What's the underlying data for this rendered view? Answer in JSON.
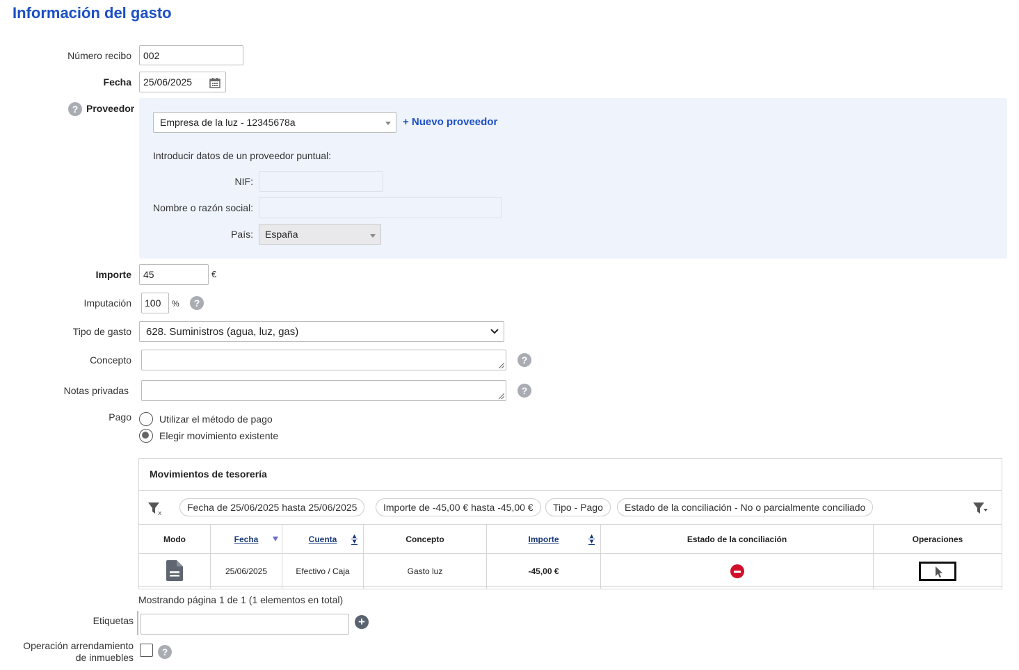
{
  "page": {
    "title": "Información del gasto"
  },
  "form": {
    "recibo": {
      "label": "Número recibo",
      "value": "002"
    },
    "fecha": {
      "label": "Fecha",
      "value": "25/06/2025"
    },
    "proveedor": {
      "label": "Proveedor",
      "selected": "Empresa de la luz - 12345678a",
      "nuevo_link": "+ Nuevo proveedor",
      "puntual_text": "Introducir datos de un proveedor puntual:",
      "nif_label": "NIF:",
      "nif_value": "",
      "nombre_label": "Nombre o razón social:",
      "nombre_value": "",
      "pais_label": "País:",
      "pais_value": "España"
    },
    "importe": {
      "label": "Importe",
      "value": "45",
      "unit": "€"
    },
    "imputacion": {
      "label": "Imputación",
      "value": "100",
      "unit": "%"
    },
    "tipo_gasto": {
      "label": "Tipo de gasto",
      "value": "628. Suministros (agua, luz, gas)"
    },
    "concepto": {
      "label": "Concepto",
      "value": ""
    },
    "notas": {
      "label": "Notas privadas",
      "value": ""
    },
    "pago": {
      "label": "Pago",
      "options": [
        {
          "label": "Utilizar el método de pago",
          "selected": false
        },
        {
          "label": "Elegir movimiento existente",
          "selected": true
        }
      ]
    },
    "etiquetas": {
      "label": "Etiquetas",
      "value": ""
    },
    "arrendamiento": {
      "label_line1": "Operación arrendamiento",
      "label_line2": "de inmuebles",
      "checked": false
    }
  },
  "movimientos": {
    "title": "Movimientos de tesorería",
    "filters": [
      "Fecha de 25/06/2025 hasta 25/06/2025",
      "Importe de -45,00 € hasta -45,00 €",
      "Tipo - Pago",
      "Estado de la conciliación - No o parcialmente conciliado"
    ],
    "columns": [
      "Modo",
      "Fecha",
      "Cuenta",
      "Concepto",
      "Importe",
      "Estado de la conciliación",
      "Operaciones"
    ],
    "rows": [
      {
        "modo_icon": "document-icon",
        "fecha": "25/06/2025",
        "cuenta": "Efectivo / Caja",
        "concepto": "Gasto luz",
        "importe": "-45,00 €",
        "estado_icon": "no-conciliado-icon",
        "op_icon": "select-cursor-icon"
      }
    ],
    "pagination": "Mostrando página 1 de 1 (1 elementos en total)"
  },
  "colors": {
    "accent": "#1c4fc4",
    "panel": "#eef3fc",
    "negative": "#c0121b",
    "stop": "#d0102a"
  }
}
